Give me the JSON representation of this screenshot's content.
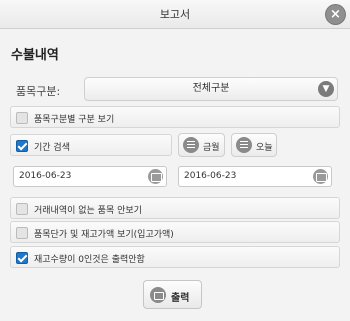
{
  "dialog": {
    "title": "보고서",
    "close_icon": "close-icon",
    "section_title": "수불내역"
  },
  "filters": {
    "category_label": "품목구분:",
    "category_value": "전체구분",
    "options": [
      {
        "label": "품목구분별 구분 보기",
        "checked": false
      },
      {
        "label": "기간 검색",
        "checked": true
      },
      {
        "label": "거래내역이 없는 품목 안보기",
        "checked": false
      },
      {
        "label": "품목단가 및 재고가액 보기(입고가액)",
        "checked": false
      },
      {
        "label": "재고수량이 0인것은 출력안함",
        "checked": true
      }
    ],
    "this_month_label": "금월",
    "today_label": "오늘",
    "start_date": "2016-06-23",
    "end_date": "2016-06-23"
  },
  "actions": {
    "print_label": "출력"
  },
  "colors": {
    "accent": "#1e77c9",
    "icon_gray": "#8a8a8a",
    "background": "#f3f3f3"
  }
}
